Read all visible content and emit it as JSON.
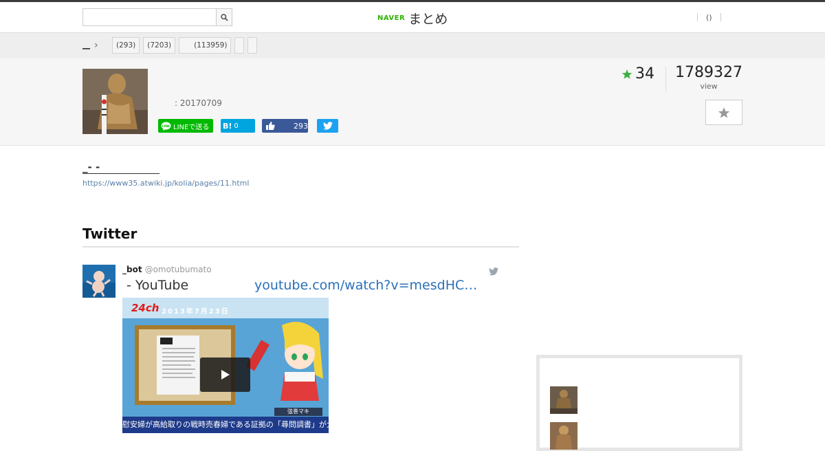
{
  "header": {
    "search": {
      "placeholder": "",
      "value": ""
    },
    "logo": {
      "brand": "NAVER",
      "product": "まとめ"
    },
    "user_link": "()"
  },
  "catbar": {
    "breadcrumb": "__",
    "tags": [
      "(293)",
      "(7203)",
      "(113959)",
      "",
      ""
    ]
  },
  "info": {
    "date": ": 20170709",
    "share": {
      "line": "LINEで送る",
      "hatena": "0",
      "facebook": "293"
    },
    "favorites": "34",
    "views": "1789327",
    "views_label": "view"
  },
  "source": {
    "title": "_-  -",
    "url": "https://www35.atwiki.jp/kolia/pages/11.html"
  },
  "twitter": {
    "section_title": "Twitter",
    "tweet": {
      "name": "_bot",
      "handle": "@omotubumato",
      "text": "- YouTube",
      "link": "youtube.com/watch?v=mesdHC…",
      "video": {
        "channel": "24ch",
        "date": "2013年7月23日",
        "caption": "慰安婦が高給取りの戦時売春婦である証拠の「尋問調書」が大発見！",
        "name_tag": "弦巻マキ"
      }
    }
  },
  "colors": {
    "accent_green": "#2db400",
    "line": "#00b900",
    "hatena": "#00a4de",
    "facebook": "#3b5998",
    "twitter": "#1da1f2",
    "link": "#2a6fb8",
    "star": "#3cb043"
  }
}
